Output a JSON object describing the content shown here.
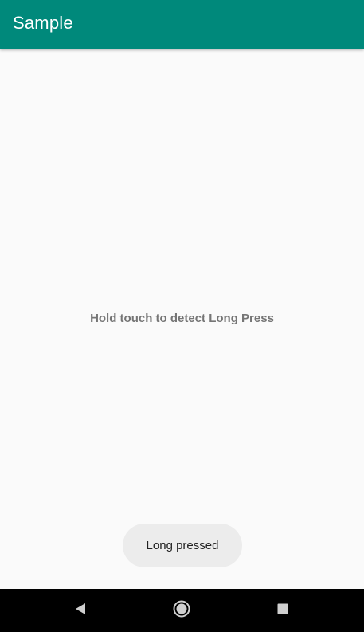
{
  "app_bar": {
    "title": "Sample",
    "color": "#00897b"
  },
  "main": {
    "instruction": "Hold touch to detect Long Press"
  },
  "toast": {
    "message": "Long pressed"
  },
  "nav_bar": {
    "icons": [
      "back-icon",
      "home-icon",
      "recents-icon"
    ]
  }
}
